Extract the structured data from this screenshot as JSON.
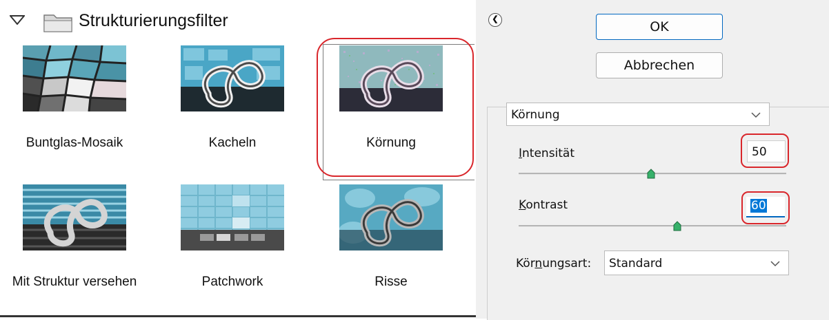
{
  "gallery": {
    "group_title": "Strukturierungsfilter",
    "items": [
      {
        "label": "Buntglas-Mosaik",
        "selected": false
      },
      {
        "label": "Kacheln",
        "selected": false
      },
      {
        "label": "Körnung",
        "selected": true
      },
      {
        "label": "Mit Struktur versehen",
        "selected": false
      },
      {
        "label": "Patchwork",
        "selected": false
      },
      {
        "label": "Risse",
        "selected": false
      }
    ]
  },
  "buttons": {
    "ok_label": "OK",
    "cancel_label": "Abbrechen"
  },
  "settings": {
    "filter_select_value": "Körnung",
    "intensity": {
      "label_first": "I",
      "label_rest": "ntensität",
      "value": "50",
      "slider_fraction": 0.5
    },
    "contrast": {
      "label_first": "K",
      "label_rest": "ontrast",
      "value": "60",
      "slider_fraction": 0.6
    },
    "grain_type": {
      "label_pre": "Kör",
      "label_ul": "n",
      "label_post": "ungsart:",
      "value": "Standard"
    }
  },
  "colors": {
    "accent": "#0067c0",
    "highlight_oval": "#d9262b",
    "panel_bg": "#f0f0f0"
  }
}
